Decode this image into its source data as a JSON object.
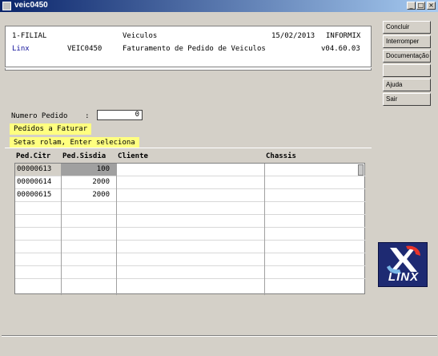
{
  "window": {
    "title": "veic0450",
    "minimize": "_",
    "maximize": "□",
    "close": "×"
  },
  "header": {
    "company": "1-FILIAL",
    "module": "Veiculos",
    "date": "15/02/2013",
    "db": "INFORMIX",
    "vendor": "Linx",
    "program": "VEIC0450",
    "program_title": "Faturamento de Pedido de Veiculos",
    "version": "v04.60.03"
  },
  "form": {
    "order_label": "Numero Pedido    :",
    "order_value": "0"
  },
  "messages": {
    "title": "Pedidos a Faturar",
    "hint": "Setas rolam, Enter seleciona"
  },
  "table": {
    "columns": [
      "Ped.Citr",
      "Ped.Sisdia",
      "Cliente",
      "Chassis"
    ],
    "rows": [
      [
        "00000613",
        "100",
        "",
        ""
      ],
      [
        "00000614",
        "2000",
        "",
        ""
      ],
      [
        "00000615",
        "2000",
        "",
        ""
      ]
    ],
    "selected_row": 0
  },
  "sidebar": {
    "buttons": [
      "Concluir",
      "Interromper",
      "Documentação",
      "",
      "Ajuda",
      "Sair"
    ]
  },
  "logo": {
    "text": "LINX"
  }
}
